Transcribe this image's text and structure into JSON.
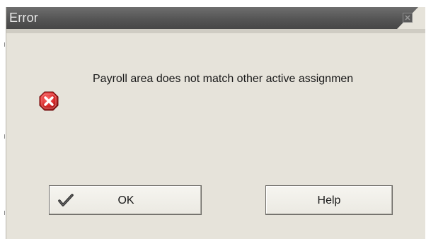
{
  "dialog": {
    "title": "Error",
    "message": "Payroll area does not match other active assignmen",
    "icon": "error-icon",
    "close_icon": "close-icon"
  },
  "buttons": {
    "ok_label": "OK",
    "ok_icon": "checkmark-icon",
    "help_label": "Help"
  },
  "colors": {
    "titlebar": "#555555",
    "dialog_bg": "#e6e3da",
    "error_red": "#d62828"
  }
}
